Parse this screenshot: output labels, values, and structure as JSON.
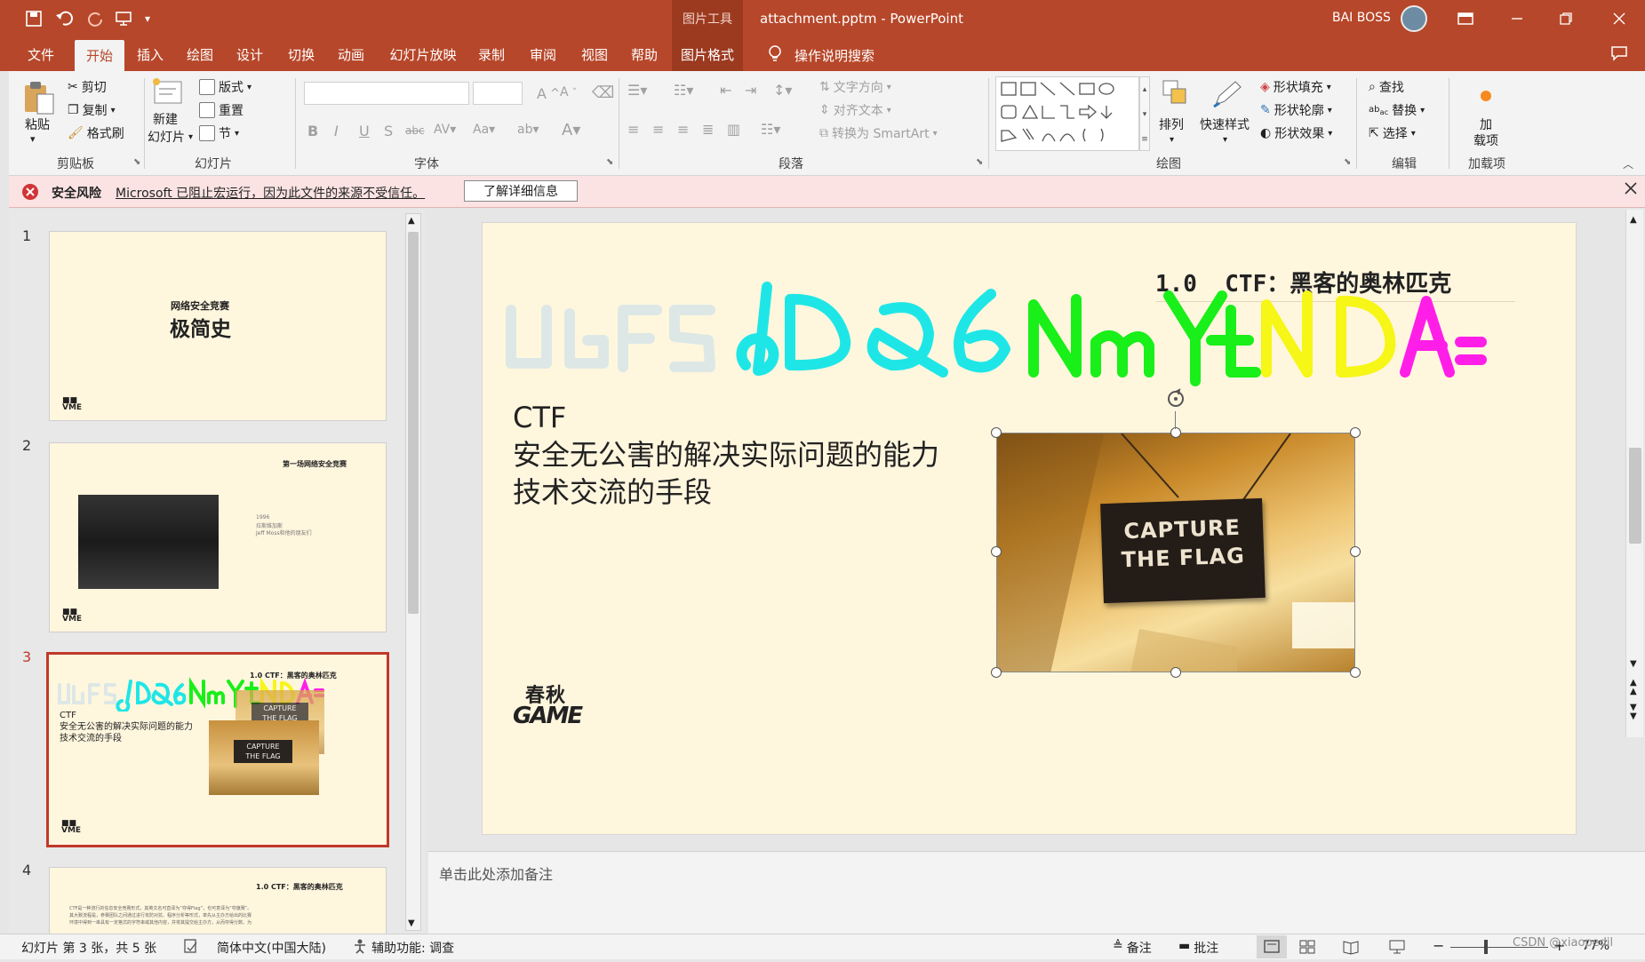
{
  "window": {
    "title": "attachment.pptm - PowerPoint",
    "context_tab": "图片工具",
    "user": "BAI BOSS"
  },
  "tabs": [
    "文件",
    "开始",
    "插入",
    "绘图",
    "设计",
    "切换",
    "动画",
    "幻灯片放映",
    "录制",
    "审阅",
    "视图",
    "帮助",
    "图片格式"
  ],
  "tell_me": "操作说明搜索",
  "ribbon": {
    "clipboard": {
      "paste": "粘贴",
      "cut": "剪切",
      "copy": "复制",
      "format_painter": "格式刷",
      "label": "剪贴板"
    },
    "slides": {
      "new_slide_1": "新建",
      "new_slide_2": "幻灯片",
      "layout": "版式",
      "reset": "重置",
      "section": "节",
      "label": "幻灯片"
    },
    "font": {
      "label": "字体"
    },
    "paragraph": {
      "text_direction": "文字方向",
      "align_text": "对齐文本",
      "smartart": "转换为 SmartArt",
      "label": "段落"
    },
    "drawing": {
      "arrange": "排列",
      "quick_styles": "快速样式",
      "shape_fill": "形状填充",
      "shape_outline": "形状轮廓",
      "shape_effects": "形状效果",
      "label": "绘图"
    },
    "editing": {
      "find": "查找",
      "replace": "替换",
      "select": "选择",
      "label": "编辑"
    },
    "addins": {
      "addin_1": "加",
      "addin_2": "载项",
      "label": "加载项"
    }
  },
  "security_bar": {
    "title": "安全风险",
    "message": "Microsoft 已阻止宏运行，因为此文件的来源不受信任。",
    "button": "了解详细信息"
  },
  "thumbnails": [
    {
      "num": "1",
      "subtitle": "网络安全竞赛",
      "title": "极简史"
    },
    {
      "num": "2",
      "title": "第一场网络安全竞赛",
      "text_1": "1996",
      "text_2": "拉斯维加斯",
      "text_3": "Jeff Moss和他的朋友们"
    },
    {
      "num": "3",
      "heading": "1.0  CTF：黑客的奥林匹克",
      "body_1": "CTF",
      "body_2": "安全无公害的解决实际问题的能力",
      "body_3": "技术交流的手段"
    },
    {
      "num": "4",
      "title": "1.0  CTF：黑客的奥林匹克",
      "text_1": "CTF是一种流行的信息安全竞赛形式，其英文名可直译为“夺得Flag”，也可意译为“夺旗赛”。",
      "text_2": "其大致流程是，参赛团队之间通过进行攻防对抗、程序分析等形式，率先从主办方给出的比赛",
      "text_3": "环境中得到一串具有一定格式的字符串或其他内容，并将其提交给主办方，从而夺得分数。为"
    }
  ],
  "slide": {
    "heading": "1.0  CTF：黑客的奥林匹克",
    "body": [
      "CTF",
      "安全无公害的解决实际问题的能力",
      "技术交流的手段"
    ],
    "handwritten": [
      "UGF5",
      "dDQ6",
      "NmYt",
      "NDA="
    ],
    "picture_sign_1": "CAPTURE",
    "picture_sign_2": "THE FLAG",
    "logo_1": "春秋",
    "logo_2": "GAME"
  },
  "notes_placeholder": "单击此处添加备注",
  "status": {
    "slide_info": "幻灯片 第 3 张，共 5 张",
    "language": "简体中文(中国大陆)",
    "accessibility": "辅助功能: 调查",
    "notes": "备注",
    "comments": "批注",
    "zoom": "77%",
    "watermark": "CSDN @xiaopedil"
  },
  "colors": {
    "accent": "#b7472a",
    "slide_bg": "#fff6de",
    "hw_faint": "#dde8e6",
    "hw_cyan": "#1fe6e6",
    "hw_green": "#19ef19",
    "hw_yellow": "#f6f617",
    "hw_magenta": "#ff1ee8"
  }
}
